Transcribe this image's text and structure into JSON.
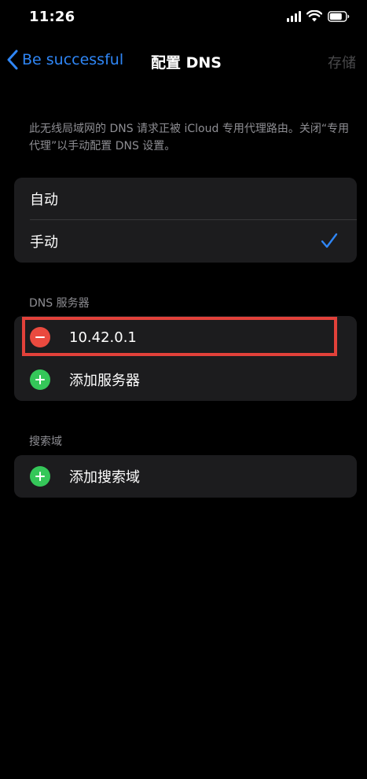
{
  "status_bar": {
    "time": "11:26"
  },
  "nav": {
    "back_label": "Be successful",
    "title": "配置 DNS",
    "save_label": "存储"
  },
  "description": "此无线局域网的 DNS 请求正被 iCloud 专用代理路由。关闭“专用代理”以手动配置 DNS 设置。",
  "mode": {
    "options": [
      "自动",
      "手动"
    ],
    "selected": "手动"
  },
  "dns_section": {
    "header": "DNS 服务器",
    "servers": [
      "10.42.0.1"
    ],
    "add_label": "添加服务器"
  },
  "search_section": {
    "header": "搜索域",
    "add_label": "添加搜索域"
  },
  "colors": {
    "accent": "#2f86f6",
    "remove": "#ea4a3f",
    "add": "#35c759",
    "highlight": "#e2413a"
  },
  "icons": [
    "signal-icon",
    "wifi-icon",
    "battery-icon",
    "chevron-left-icon",
    "checkmark-icon",
    "remove-icon",
    "add-icon"
  ]
}
